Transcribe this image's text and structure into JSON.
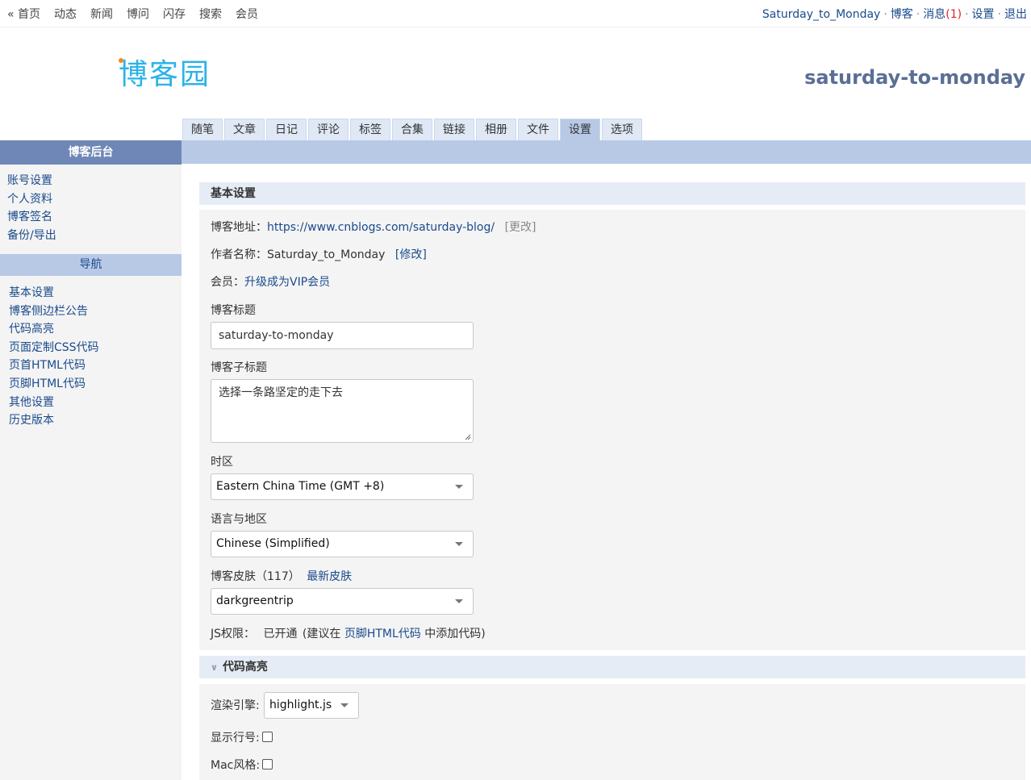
{
  "topnav": {
    "items": [
      "« 首页",
      "动态",
      "新闻",
      "博问",
      "闪存",
      "搜索",
      "会员"
    ],
    "user": "Saturday_to_Monday",
    "blog": "博客",
    "messages": "消息",
    "message_count": "(1)",
    "settings": "设置",
    "logout": "退出",
    "sep": "·"
  },
  "header": {
    "logo": "博客园",
    "blog_name": "saturday-to-monday"
  },
  "tabs": [
    "随笔",
    "文章",
    "日记",
    "评论",
    "标签",
    "合集",
    "链接",
    "相册",
    "文件",
    "设置",
    "选项"
  ],
  "active_tab": "设置",
  "sidebar": {
    "title": "博客后台",
    "account_items": [
      "账号设置",
      "个人资料",
      "博客签名",
      "备份/导出"
    ],
    "nav_title": "导航",
    "nav_items": [
      "基本设置",
      "博客侧边栏公告",
      "代码高亮",
      "页面定制CSS代码",
      "页首HTML代码",
      "页脚HTML代码",
      "其他设置",
      "历史版本"
    ]
  },
  "basic": {
    "title": "基本设置",
    "address_label": "博客地址：",
    "address_url": "https://www.cnblogs.com/saturday-blog/",
    "address_change": "[更改]",
    "author_label": "作者名称：",
    "author_name": "Saturday_to_Monday",
    "author_edit": "[修改]",
    "member_label": "会员：",
    "member_link": "升级成为VIP会员",
    "blog_title_label": "博客标题",
    "blog_title_value": "saturday-to-monday",
    "subtitle_label": "博客子标题",
    "subtitle_value": "选择一条路坚定的走下去",
    "timezone_label": "时区",
    "timezone_value": "Eastern China Time (GMT +8)",
    "language_label": "语言与地区",
    "language_value": "Chinese (Simplified)",
    "skin_label": "博客皮肤（117）",
    "skin_link": "最新皮肤",
    "skin_value": "darkgreentrip",
    "js_label": "JS权限：",
    "js_status": "已开通",
    "js_hint_pre": "(建议在",
    "js_hint_link": "页脚HTML代码",
    "js_hint_post": "中添加代码)"
  },
  "highlight": {
    "title": "代码高亮",
    "engine_label": "渲染引擎:",
    "engine_value": "highlight.js",
    "line_numbers_label": "显示行号:",
    "mac_style_label": "Mac风格:"
  }
}
